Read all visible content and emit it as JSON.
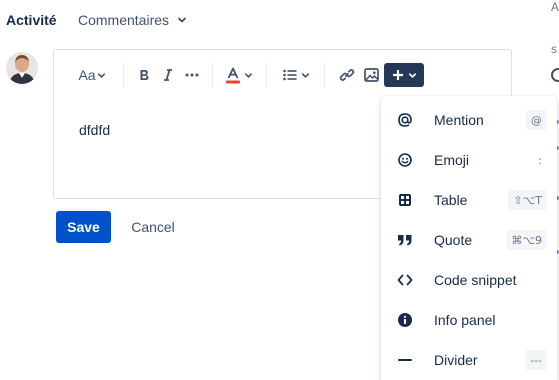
{
  "header": {
    "title": "Activité",
    "tab_label": "Commentaires"
  },
  "edge": {
    "top_letter": "A",
    "mid_letter": "s"
  },
  "editor": {
    "text_style_label": "Aa",
    "content": "dfdfd"
  },
  "actions": {
    "save_label": "Save",
    "cancel_label": "Cancel"
  },
  "insert_menu": {
    "items": [
      {
        "label": "Mention",
        "shortcut": "@",
        "icon": "at-icon"
      },
      {
        "label": "Emoji",
        "shortcut": ":",
        "icon": "emoji-icon"
      },
      {
        "label": "Table",
        "shortcut": "⇧⌥T",
        "icon": "table-icon"
      },
      {
        "label": "Quote",
        "shortcut": "⌘⌥9",
        "icon": "quote-icon"
      },
      {
        "label": "Code snippet",
        "shortcut": "",
        "icon": "code-icon"
      },
      {
        "label": "Info panel",
        "shortcut": "",
        "icon": "info-icon"
      },
      {
        "label": "Divider",
        "shortcut": "---",
        "icon": "divider-icon"
      }
    ]
  },
  "colors": {
    "primary": "#0052cc",
    "plus_button": "#253858",
    "text": "#172b4d",
    "subtle": "#42526e"
  }
}
